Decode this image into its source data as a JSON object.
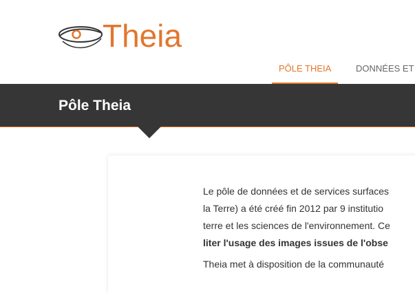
{
  "header": {
    "logo_text": "Theia",
    "nav": [
      {
        "label": "PÔLE THEIA",
        "active": true
      },
      {
        "label": "DONNÉES ET"
      }
    ]
  },
  "band": {
    "title": "Pôle Theia"
  },
  "content": {
    "lines": [
      "Le pôle de données et de services surfaces",
      "la Terre) a été créé fin 2012 par 9 institutio",
      "terre et les sciences de l'environnement. Ce"
    ],
    "bold_line": "liter l'usage des images issues de l'obse",
    "second_paragraph": "Theia met à disposition de la communauté"
  },
  "colors": {
    "accent": "#e2762c",
    "band": "#363636",
    "text": "#333333"
  }
}
